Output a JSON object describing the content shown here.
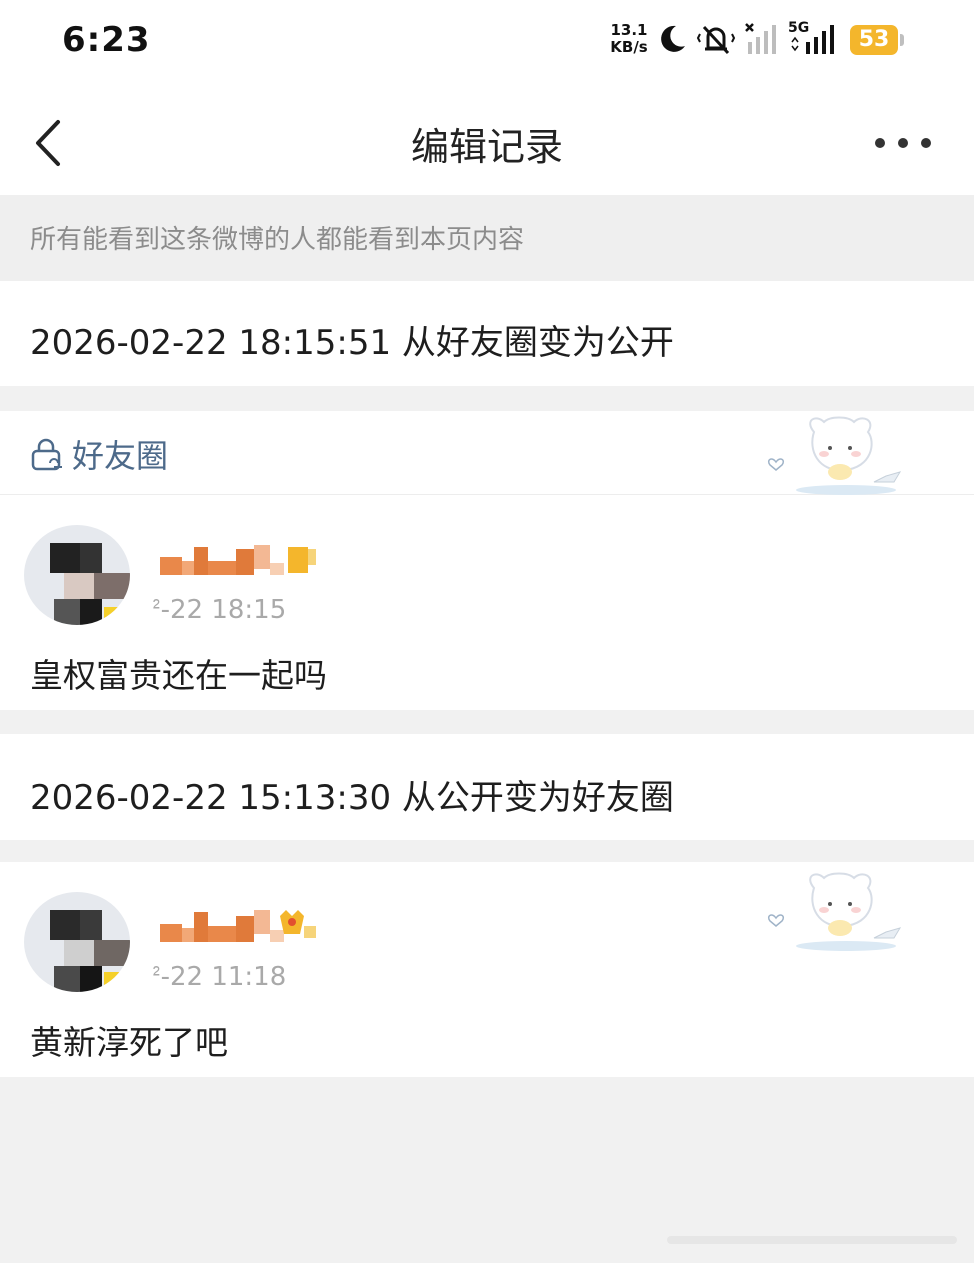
{
  "status_bar": {
    "time": "6:23",
    "net_speed_value": "13.1",
    "net_speed_unit": "KB/s",
    "network_type": "5G",
    "battery": "53",
    "battery_color": "#f4b62c"
  },
  "header": {
    "title": "编辑记录"
  },
  "notice": "所有能看到这条微博的人都能看到本页内容",
  "records": [
    {
      "text": "2026-02-22 18:15:51 从好友圈变为公开"
    },
    {
      "text": "2026-02-22 15:13:30 从公开变为好友圈"
    }
  ],
  "visibility_label": "好友圈",
  "posts": [
    {
      "time": "ᒾ-22 18:15",
      "content": "皇权富贵还在一起吗"
    },
    {
      "time": "ᒾ-22 11:18",
      "content": "黄新淳死了吧"
    }
  ],
  "colors": {
    "link_blue": "#4d6a8a",
    "username_orange": "#e9884a",
    "background": "#f1f1f1"
  }
}
